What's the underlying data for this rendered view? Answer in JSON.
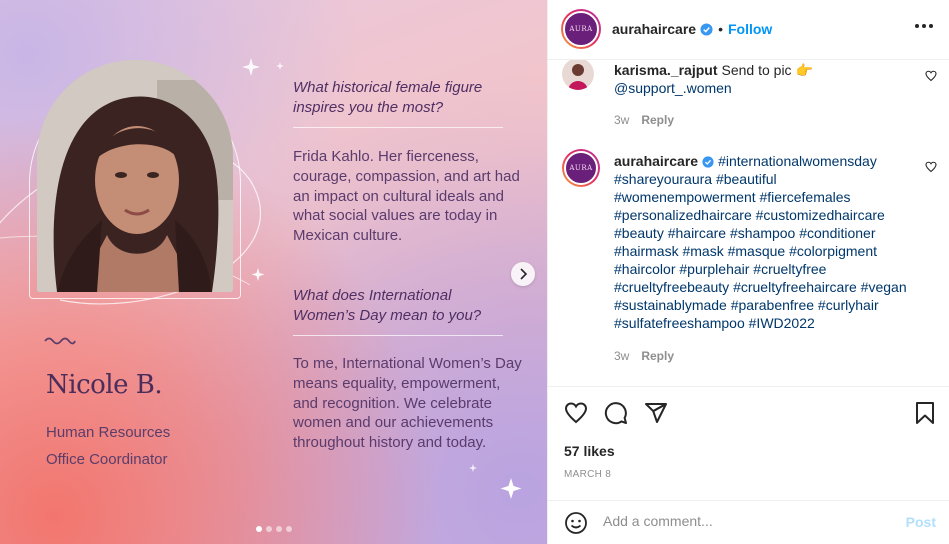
{
  "post_image": {
    "person_name": "Nicole B.",
    "role_line1": "Human Resources",
    "role_line2": "Office Coordinator",
    "question1": "What historical female figure inspires you the most?",
    "answer1": "Frida Kahlo. Her fierceness, courage, compassion, and art had an impact on cultural ideals and what social values are today in Mexican culture.",
    "question2": "What does International Women’s Day mean to you?",
    "answer2": "To me, International Women’s Day means equality, empowerment, and recognition. We celebrate women and our achievements throughout history and today.",
    "carousel_dots": 4,
    "active_dot": 0,
    "next_icon": "chevron-right-icon"
  },
  "header": {
    "avatar_text": "AURA",
    "username": "aurahaircare",
    "separator": "•",
    "follow_label": "Follow",
    "more_icon": "more-horizontal-icon"
  },
  "comments": [
    {
      "username": "karisma._rajput",
      "text": "Send to pic 👉",
      "mention": "@support_.women",
      "time": "3w",
      "reply_label": "Reply"
    },
    {
      "username": "aurahaircare",
      "avatar_text": "AURA",
      "hashtags": "#internationalwomensday #shareyouraura #beautiful #womenempowerment #fiercefemales #personalizedhaircare #customizedhaircare #beauty #haircare #shampoo #conditioner #hairmask #mask #masque #colorpigment #haircolor #purplehair #crueltyfree #crueltyfreebeauty #crueltyfreehaircare #vegan #sustainablymade #parabenfree #curlyhair #sulfatefreeshampoo #IWD2022",
      "time": "3w",
      "reply_label": "Reply"
    }
  ],
  "actions": {
    "likes": "57 likes",
    "date": "MARCH 8"
  },
  "add_comment": {
    "placeholder": "Add a comment...",
    "post_label": "Post"
  },
  "colors": {
    "link_blue": "#0095f6",
    "hashtag": "#00376b",
    "muted": "#8e8e8e",
    "text": "#262626"
  }
}
